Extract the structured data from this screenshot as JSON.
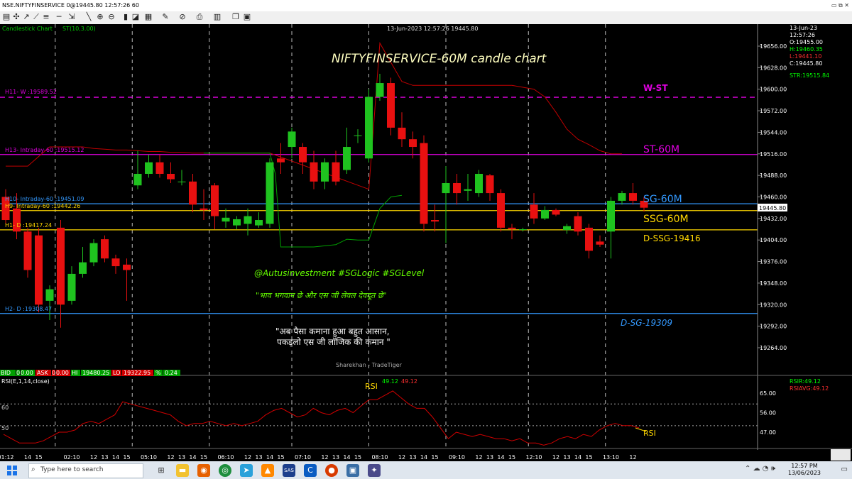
{
  "window": {
    "title": "NSE.NIFTYFINSERVICE 0@19445.80 12:57:26 60",
    "controls": "▭ ⧉ ✕"
  },
  "toolbar": {
    "icons": [
      "new-chart-icon",
      "crosshair-icon",
      "draw-line-icon",
      "trendline-icon",
      "fibonacci-icon",
      "horizontal-line-icon",
      "channel-icon",
      "text-icon",
      "zoom-in-icon",
      "zoom-out-icon",
      "pan-icon",
      "indicator-icon",
      "template-icon",
      "eraser-icon",
      "lock-icon",
      "print-icon"
    ]
  },
  "header": {
    "chart_type": "Candlestick Chart",
    "indicator": "ST(10,3.00)",
    "datetime": "13-Jun-2023 12:57:26 19445.80"
  },
  "ohlc": {
    "date": "13-Jun-23",
    "time": "12:57:26",
    "open": "O:19455.00",
    "high": "H:19460.35",
    "low": "L:19441.10",
    "close": "C:19445.80",
    "str": "STR:19515.84"
  },
  "quote": {
    "bid_label": "BID",
    "bid": "0",
    "bid2": "0.00",
    "ask_label": "ASK",
    "ask": "0",
    "ask2": "0.00",
    "hi_label": "HI",
    "hi": "19480.25",
    "lo_label": "LO",
    "lo": "19322.95",
    "pct_label": "%",
    "pct": "0.24"
  },
  "rsi_panel": {
    "label": "RSI(E,1,14,close)",
    "value_label": "RSI",
    "v1": "49.12",
    "v2": "49.12",
    "side_rsir": "RSIR:49.12",
    "side_rsiavg": "RSIAVG:49.12",
    "level_60": "60",
    "level_50": "50"
  },
  "levels_labels": {
    "h11": "H11- W :19589.52",
    "h13": "H13- Intraday-60 :19515.12",
    "h10": "H10- Intraday-60 :19451.09",
    "h9": "H9- Intraday-60 :19442.26",
    "h1": "H1- D :19417.24",
    "h2": "H2- D :19308.47"
  },
  "annotations": {
    "title": "NIFTYFINSERVICE-60M candle chart",
    "wst": "W-ST",
    "st60": "ST-60M",
    "sg60": "SG-60M",
    "ssg60": "SSG-60M",
    "dssg": "D-SSG-19416",
    "dsg": "D-SG-19309",
    "handle": "@Autusinvestment  #SGLogic  #SGLevel",
    "quote1": "\"भाव भगवान छे और एस जी लेवल देवदूत छे\"",
    "quote2a": "\"अब पैसा कमाना हुआ बहुत आसान,",
    "quote2b": "पकड़लो एस जी लॉजिक की कमान \"",
    "watermark": "Sharekhan - TradeTiger",
    "rsi_note": "RSI",
    "last_price": "19445.80"
  },
  "chart_data": {
    "type": "candlestick",
    "title": "NIFTYFINSERVICE-60M candle chart",
    "ylim": [
      19240,
      19690
    ],
    "y_ticks": [
      19656.0,
      19628.0,
      19600.0,
      19572.0,
      19544.0,
      19516.0,
      19488.0,
      19460.0,
      19432.0,
      19404.0,
      19376.0,
      19348.0,
      19320.0,
      19292.0,
      19264.0
    ],
    "x_ticks": [
      {
        "label": "01:12",
        "i": 0
      },
      {
        "label": "14",
        "i": 2
      },
      {
        "label": "15",
        "i": 3
      },
      {
        "label": "02:10",
        "i": 6
      },
      {
        "label": "12",
        "i": 8
      },
      {
        "label": "13",
        "i": 9
      },
      {
        "label": "14",
        "i": 10
      },
      {
        "label": "15",
        "i": 11
      },
      {
        "label": "05:10",
        "i": 13
      },
      {
        "label": "12",
        "i": 15
      },
      {
        "label": "13",
        "i": 16
      },
      {
        "label": "14",
        "i": 17
      },
      {
        "label": "15",
        "i": 18
      },
      {
        "label": "06:10",
        "i": 20
      },
      {
        "label": "12",
        "i": 22
      },
      {
        "label": "13",
        "i": 23
      },
      {
        "label": "14",
        "i": 24
      },
      {
        "label": "15",
        "i": 25
      },
      {
        "label": "07:10",
        "i": 27
      },
      {
        "label": "12",
        "i": 29
      },
      {
        "label": "13",
        "i": 30
      },
      {
        "label": "14",
        "i": 31
      },
      {
        "label": "15",
        "i": 32
      },
      {
        "label": "08:10",
        "i": 34
      },
      {
        "label": "12",
        "i": 36
      },
      {
        "label": "13",
        "i": 37
      },
      {
        "label": "14",
        "i": 38
      },
      {
        "label": "15",
        "i": 39
      },
      {
        "label": "09:10",
        "i": 41
      },
      {
        "label": "12",
        "i": 43
      },
      {
        "label": "13",
        "i": 44
      },
      {
        "label": "14",
        "i": 45
      },
      {
        "label": "15",
        "i": 46
      },
      {
        "label": "12:10",
        "i": 48
      },
      {
        "label": "12",
        "i": 50
      },
      {
        "label": "13",
        "i": 51
      },
      {
        "label": "14",
        "i": 52
      },
      {
        "label": "15",
        "i": 53
      },
      {
        "label": "13:10",
        "i": 55
      },
      {
        "label": "12",
        "i": 57
      }
    ],
    "candles": [
      {
        "o": 19460,
        "h": 19470,
        "l": 19425,
        "c": 19430
      },
      {
        "o": 19445,
        "h": 19465,
        "l": 19405,
        "c": 19415
      },
      {
        "o": 19415,
        "h": 19420,
        "l": 19355,
        "c": 19365
      },
      {
        "o": 19410,
        "h": 19420,
        "l": 19310,
        "c": 19320
      },
      {
        "o": 19325,
        "h": 19345,
        "l": 19300,
        "c": 19340
      },
      {
        "o": 19420,
        "h": 19430,
        "l": 19290,
        "c": 19320
      },
      {
        "o": 19325,
        "h": 19370,
        "l": 19320,
        "c": 19360
      },
      {
        "o": 19360,
        "h": 19395,
        "l": 19355,
        "c": 19375
      },
      {
        "o": 19375,
        "h": 19405,
        "l": 19370,
        "c": 19400
      },
      {
        "o": 19405,
        "h": 19410,
        "l": 19375,
        "c": 19380
      },
      {
        "o": 19380,
        "h": 19385,
        "l": 19360,
        "c": 19370
      },
      {
        "o": 19372,
        "h": 19380,
        "l": 19325,
        "c": 19365
      },
      {
        "o": 19475,
        "h": 19520,
        "l": 19470,
        "c": 19490
      },
      {
        "o": 19490,
        "h": 19515,
        "l": 19485,
        "c": 19505
      },
      {
        "o": 19505,
        "h": 19515,
        "l": 19485,
        "c": 19490
      },
      {
        "o": 19490,
        "h": 19505,
        "l": 19478,
        "c": 19483
      },
      {
        "o": 19480,
        "h": 19495,
        "l": 19475,
        "c": 19480
      },
      {
        "o": 19480,
        "h": 19490,
        "l": 19440,
        "c": 19450
      },
      {
        "o": 19445,
        "h": 19470,
        "l": 19430,
        "c": 19443
      },
      {
        "o": 19475,
        "h": 19478,
        "l": 19418,
        "c": 19435
      },
      {
        "o": 19428,
        "h": 19445,
        "l": 19420,
        "c": 19433
      },
      {
        "o": 19423,
        "h": 19435,
        "l": 19418,
        "c": 19431
      },
      {
        "o": 19425,
        "h": 19445,
        "l": 19410,
        "c": 19435
      },
      {
        "o": 19423,
        "h": 19440,
        "l": 19420,
        "c": 19430
      },
      {
        "o": 19425,
        "h": 19510,
        "l": 19420,
        "c": 19505
      },
      {
        "o": 19510,
        "h": 19530,
        "l": 19490,
        "c": 19505
      },
      {
        "o": 19525,
        "h": 19550,
        "l": 19510,
        "c": 19545
      },
      {
        "o": 19525,
        "h": 19530,
        "l": 19490,
        "c": 19505
      },
      {
        "o": 19505,
        "h": 19520,
        "l": 19470,
        "c": 19480
      },
      {
        "o": 19480,
        "h": 19510,
        "l": 19470,
        "c": 19505
      },
      {
        "o": 19505,
        "h": 19520,
        "l": 19475,
        "c": 19480
      },
      {
        "o": 19495,
        "h": 19550,
        "l": 19490,
        "c": 19525
      },
      {
        "o": 19540,
        "h": 19548,
        "l": 19530,
        "c": 19540
      },
      {
        "o": 19510,
        "h": 19600,
        "l": 19505,
        "c": 19590
      },
      {
        "o": 19590,
        "h": 19620,
        "l": 19585,
        "c": 19608
      },
      {
        "o": 19608,
        "h": 19615,
        "l": 19540,
        "c": 19550
      },
      {
        "o": 19550,
        "h": 19570,
        "l": 19525,
        "c": 19535
      },
      {
        "o": 19535,
        "h": 19545,
        "l": 19510,
        "c": 19525
      },
      {
        "o": 19530,
        "h": 19540,
        "l": 19415,
        "c": 19425
      },
      {
        "o": 19430,
        "h": 19450,
        "l": 19415,
        "c": 19428
      },
      {
        "o": 19465,
        "h": 19500,
        "l": 19400,
        "c": 19478
      },
      {
        "o": 19478,
        "h": 19490,
        "l": 19450,
        "c": 19465
      },
      {
        "o": 19468,
        "h": 19490,
        "l": 19455,
        "c": 19470
      },
      {
        "o": 19465,
        "h": 19495,
        "l": 19460,
        "c": 19490
      },
      {
        "o": 19488,
        "h": 19490,
        "l": 19455,
        "c": 19465
      },
      {
        "o": 19465,
        "h": 19470,
        "l": 19415,
        "c": 19420
      },
      {
        "o": 19420,
        "h": 19425,
        "l": 19405,
        "c": 19418
      },
      {
        "o": 19418,
        "h": 19420,
        "l": 19415,
        "c": 19418
      },
      {
        "o": 19450,
        "h": 19465,
        "l": 19425,
        "c": 19432
      },
      {
        "o": 19432,
        "h": 19448,
        "l": 19430,
        "c": 19443
      },
      {
        "o": 19443,
        "h": 19445,
        "l": 19435,
        "c": 19437
      },
      {
        "o": 19417,
        "h": 19425,
        "l": 19412,
        "c": 19422
      },
      {
        "o": 19435,
        "h": 19440,
        "l": 19410,
        "c": 19415
      },
      {
        "o": 19420,
        "h": 19425,
        "l": 19380,
        "c": 19390
      },
      {
        "o": 19402,
        "h": 19410,
        "l": 19395,
        "c": 19398
      },
      {
        "o": 19415,
        "h": 19460,
        "l": 19380,
        "c": 19455
      },
      {
        "o": 19455,
        "h": 19468,
        "l": 19450,
        "c": 19465
      },
      {
        "o": 19465,
        "h": 19478,
        "l": 19450,
        "c": 19455
      },
      {
        "o": 19455,
        "h": 19460,
        "l": 19441,
        "c": 19446
      }
    ],
    "supertrend_red": [
      [
        0,
        19500
      ],
      [
        2,
        19500
      ],
      [
        4,
        19525
      ],
      [
        5,
        19525
      ],
      [
        6,
        19525
      ],
      [
        7,
        19525
      ],
      [
        8,
        19523
      ],
      [
        9,
        19522
      ],
      [
        10,
        19521
      ],
      [
        11,
        19521
      ],
      [
        12,
        19520
      ],
      [
        13,
        19519
      ],
      [
        14,
        19519
      ],
      [
        15,
        19518
      ],
      [
        16,
        19518
      ],
      [
        17,
        19517
      ],
      [
        18,
        19517
      ],
      [
        19,
        19517
      ],
      [
        20,
        19517
      ],
      [
        21,
        19517
      ],
      [
        22,
        19517
      ],
      [
        23,
        19517
      ],
      [
        24,
        19517
      ],
      [
        33,
        19470
      ],
      [
        34,
        19660
      ],
      [
        36,
        19610
      ],
      [
        37,
        19605
      ],
      [
        40,
        19605
      ],
      [
        41,
        19605
      ],
      [
        45,
        19605
      ],
      [
        46,
        19605
      ],
      [
        48,
        19600
      ],
      [
        49,
        19590
      ],
      [
        50,
        19570
      ],
      [
        51,
        19548
      ],
      [
        52,
        19535
      ],
      [
        53,
        19528
      ],
      [
        54,
        19520
      ],
      [
        55,
        19516
      ],
      [
        56,
        19516
      ]
    ],
    "supertrend_green": [
      [
        18,
        19517
      ],
      [
        23,
        19517
      ],
      [
        24,
        19517
      ],
      [
        24.5,
        19490
      ],
      [
        25,
        19395
      ],
      [
        26,
        19395
      ],
      [
        28,
        19395
      ],
      [
        30,
        19398
      ],
      [
        31,
        19405
      ],
      [
        32,
        19404
      ],
      [
        33,
        19404
      ],
      [
        34,
        19445
      ],
      [
        35,
        19460
      ],
      [
        36,
        19462
      ]
    ],
    "levels": [
      {
        "name": "W-ST",
        "value": 19589.52,
        "color": "#e000e0",
        "style": "dashed"
      },
      {
        "name": "ST-60M",
        "value": 19515.12,
        "color": "#e000e0",
        "style": "solid"
      },
      {
        "name": "SG-60M",
        "value": 19451.09,
        "color": "#3399ff",
        "style": "solid"
      },
      {
        "name": "SSG-60M",
        "value": 19442.26,
        "color": "#ffd700",
        "style": "solid"
      },
      {
        "name": "D-SSG-19416",
        "value": 19417.24,
        "color": "#ffd700",
        "style": "solid"
      },
      {
        "name": "D-SG-19309",
        "value": 19308.47,
        "color": "#3399ff",
        "style": "solid"
      }
    ],
    "rsi": {
      "ylim": [
        40,
        70
      ],
      "ticks": [
        65.0,
        56.0,
        47.0
      ],
      "levels": [
        60,
        50
      ],
      "values": [
        46,
        44,
        42,
        42,
        42,
        43,
        45,
        47,
        47,
        48,
        51,
        52,
        51,
        53,
        55,
        61,
        60,
        59,
        58,
        57,
        56,
        55,
        52,
        50,
        51,
        51,
        52,
        51,
        50,
        51,
        50,
        51,
        52,
        55,
        57,
        58,
        56,
        54,
        55,
        58,
        56,
        55,
        57,
        58,
        56,
        59,
        62,
        62,
        64,
        66,
        63,
        60,
        58,
        58,
        54,
        49,
        44,
        47,
        46,
        45,
        46,
        45,
        44,
        44,
        43,
        44,
        42,
        42,
        41,
        42,
        44,
        45,
        44,
        46,
        45,
        48,
        50,
        51,
        50,
        50,
        49
      ]
    },
    "last_price": 19445.8
  }
}
